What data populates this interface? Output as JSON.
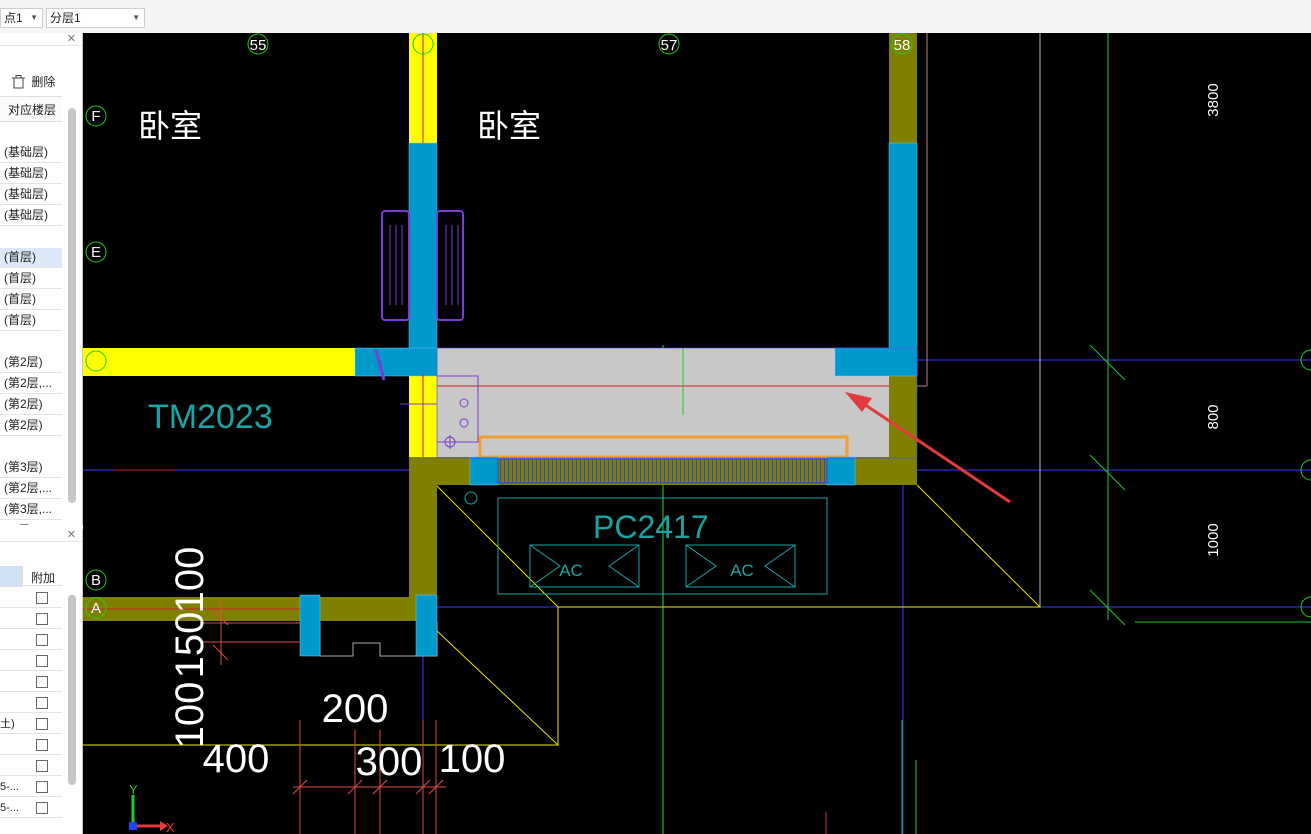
{
  "toolbar": {
    "combo1_value": "点1",
    "combo2_value": "分层1"
  },
  "floor_panel": {
    "delete_label": "删除",
    "column_header": "对应楼层",
    "rows": [
      "(基础层)",
      "(基础层)",
      "(基础层)",
      "(基础层)",
      "(首层)",
      "(首层)",
      "(首层)",
      "(首层)",
      "(第2层)",
      "(第2层,...",
      "(第2层)",
      "(第2层)",
      "(第3层)",
      "(第2层,...",
      "(第3层,...",
      "(...层)"
    ],
    "selected_row_index": 4
  },
  "property_panel": {
    "column_header": "附加",
    "rows": [
      "",
      "",
      "",
      "",
      "",
      "",
      "土)",
      "",
      "",
      "5-...",
      "5-..."
    ]
  },
  "drawing": {
    "axis_top": [
      "55",
      "57",
      "58"
    ],
    "axis_left": [
      "F",
      "E",
      "B",
      "A"
    ],
    "room_labels": [
      "卧室",
      "卧室"
    ],
    "door_label": "TM2023",
    "window_label": "PC2417",
    "ac_labels": [
      "AC",
      "AC"
    ],
    "dim_right": [
      "3800",
      "800",
      "1000"
    ],
    "dim_left_vertical": [
      "100",
      "150",
      "100"
    ],
    "dim_bottom": [
      "200",
      "400",
      "300",
      "100"
    ],
    "ucs_x": "X",
    "ucs_y": "Y"
  },
  "colors": {
    "canvas_bg": "#000000",
    "wall_olive": "#808000",
    "wall_yellow": "#ffff00",
    "column_cyan": "#0099cc",
    "slab_gray": "#c8c8c8",
    "arrow_red": "#e23b3b",
    "text_cyan": "#19a5a5"
  }
}
